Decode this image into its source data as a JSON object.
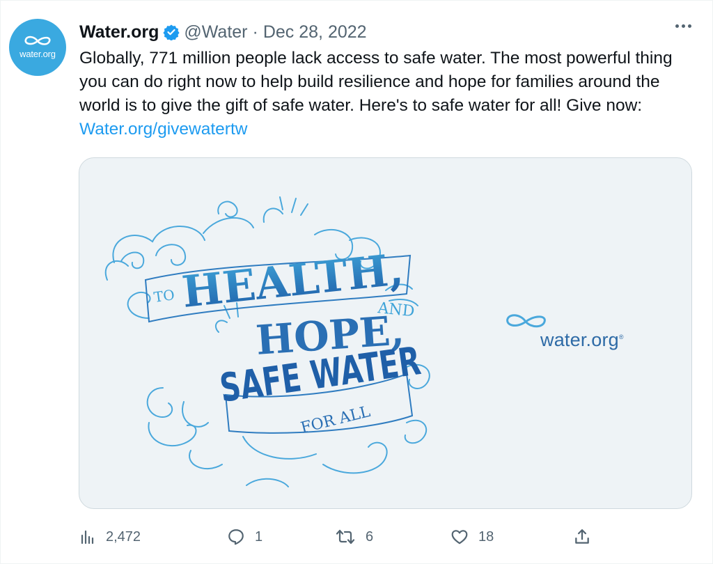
{
  "tweet": {
    "avatar_text": "water.org",
    "author_name": "Water.org",
    "handle": "@Water",
    "separator": "·",
    "date": "Dec 28, 2022",
    "text_main": "Globally, 771 million people lack access to safe water. The most powerful thing you can do right now to help build resilience and hope for families around the world is to give the gift of safe water. Here's to safe water for all! Give now: ",
    "text_link": "Water.org/givewatertw"
  },
  "media": {
    "line_to": "TO",
    "line_health": "HEALTH,",
    "line_hope": "HOPE,",
    "line_and": "AND",
    "line_safe_water": "SAFE WATER",
    "line_for_all": "FOR ALL",
    "brand": "water.org",
    "brand_reg": "®"
  },
  "actions": {
    "views": "2,472",
    "replies": "1",
    "retweets": "6",
    "likes": "18"
  },
  "colors": {
    "verified": "#1d9bf0",
    "link": "#1d9bf0",
    "avatar_bg": "#3aa9e0",
    "media_bg": "#eef3f6",
    "lettering_dark": "#1f5fa8",
    "lettering_light": "#3ea3d8"
  },
  "icons": [
    "verified-badge-icon",
    "more-dots-icon",
    "views-icon",
    "reply-icon",
    "retweet-icon",
    "like-icon",
    "share-icon",
    "infinity-water-logo-icon"
  ]
}
